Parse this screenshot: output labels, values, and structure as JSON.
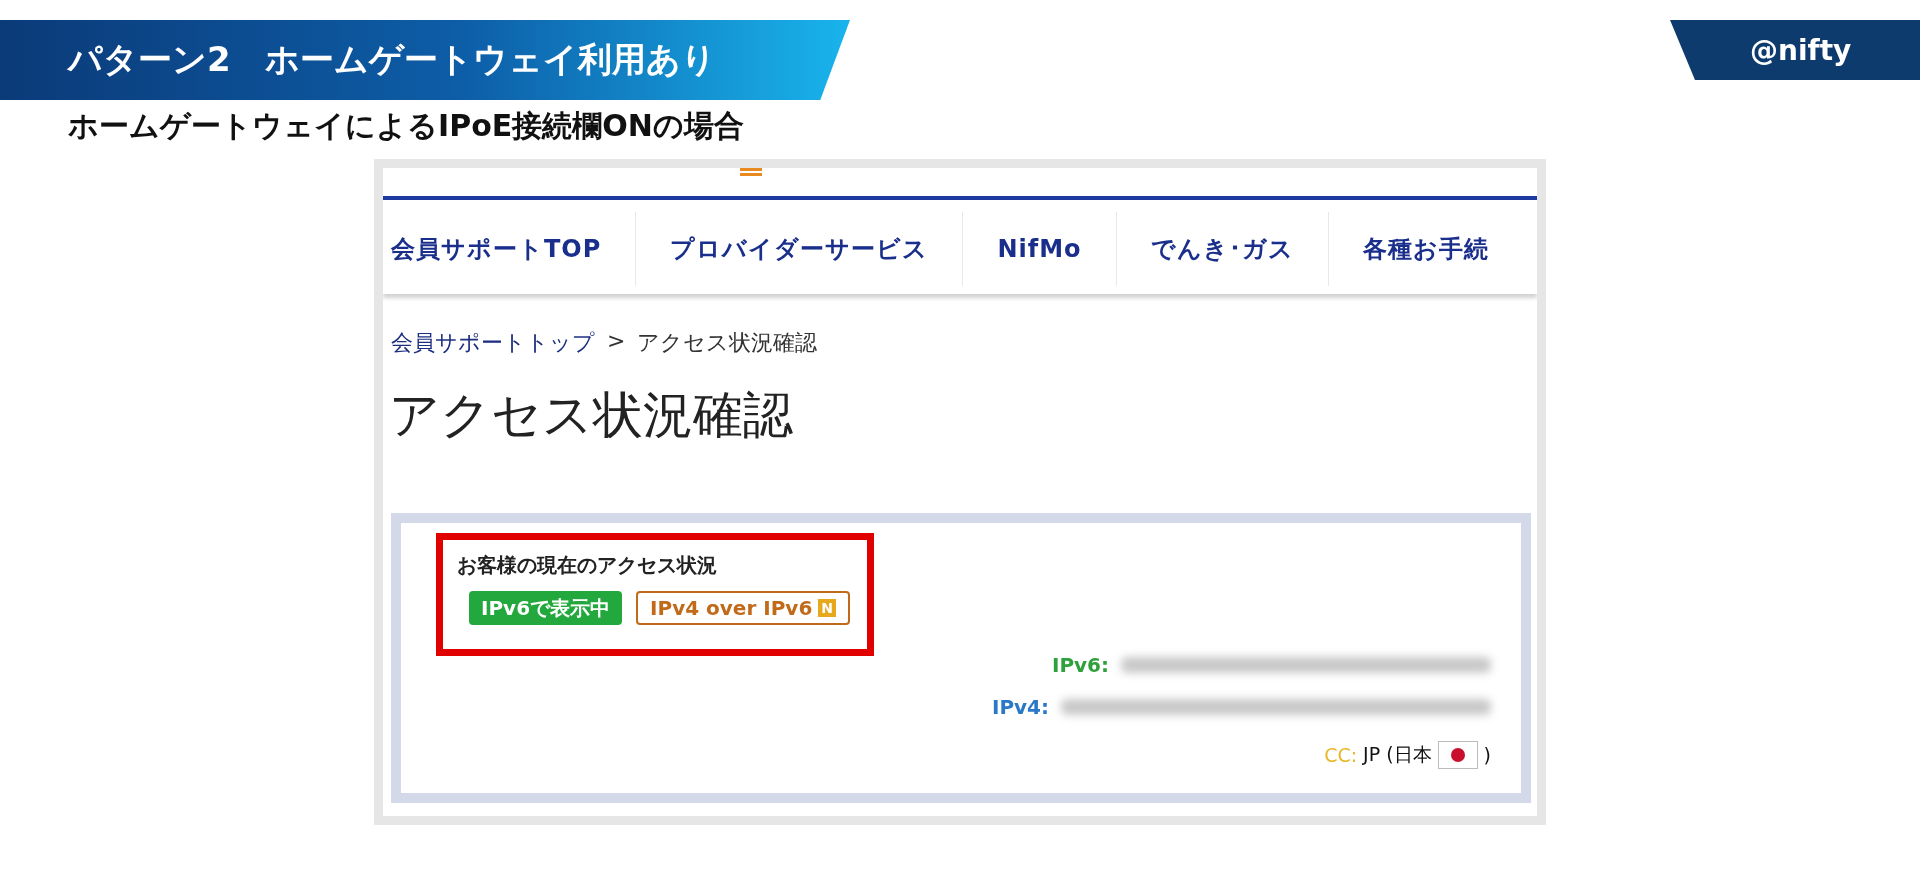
{
  "slide": {
    "title": "パターン2　ホームゲートウェイ利用あり",
    "brand": "@nifty",
    "subtitle": "ホームゲートウェイによるIPoE接続欄ONの場合"
  },
  "site": {
    "nav": [
      {
        "label": "会員サポートTOP"
      },
      {
        "label": "プロバイダーサービス"
      },
      {
        "label": "NifMo"
      },
      {
        "label": "でんき･ガス"
      },
      {
        "label": "各種お手続"
      }
    ],
    "breadcrumb": {
      "link": "会員サポートトップ",
      "separator": ">",
      "current": "アクセス状況確認"
    },
    "page_title": "アクセス状況確認",
    "status": {
      "heading": "お客様の現在のアクセス状況",
      "badges": [
        {
          "kind": "ipv6",
          "label": "IPv6で表示中"
        },
        {
          "kind": "v4over6",
          "label": "IPv4 over IPv6",
          "mark": "N"
        }
      ],
      "rows": [
        {
          "label": "IPv6:",
          "color": "#2ea03c"
        },
        {
          "label": "IPv4:",
          "color": "#2a78c8"
        }
      ],
      "cc": {
        "label": "CC:",
        "value": "JP (日本",
        "close": ")"
      }
    }
  }
}
